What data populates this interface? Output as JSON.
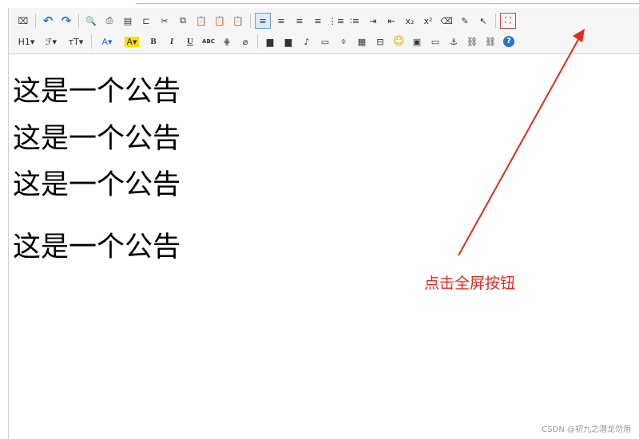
{
  "toolbar": {
    "row1": [
      {
        "name": "source-icon",
        "glyph": "⌧"
      },
      {
        "sep": true
      },
      {
        "name": "undo-icon",
        "glyph": "↶"
      },
      {
        "name": "redo-icon",
        "glyph": "↷"
      },
      {
        "sep": true
      },
      {
        "name": "preview-icon",
        "glyph": "🔍"
      },
      {
        "name": "print-icon",
        "glyph": "⎙"
      },
      {
        "name": "template-icon",
        "glyph": "▤"
      },
      {
        "name": "code-icon",
        "glyph": "⊏"
      },
      {
        "name": "cut-icon",
        "glyph": "✂"
      },
      {
        "name": "copy-icon",
        "glyph": "⧉"
      },
      {
        "name": "paste-icon",
        "glyph": "📋"
      },
      {
        "name": "paste-text-icon",
        "glyph": "📋"
      },
      {
        "name": "paste-word-icon",
        "glyph": "📋"
      },
      {
        "sep": true
      },
      {
        "name": "align-left-icon",
        "glyph": "≡",
        "active": true
      },
      {
        "name": "align-center-icon",
        "glyph": "≡"
      },
      {
        "name": "align-right-icon",
        "glyph": "≡"
      },
      {
        "name": "align-justify-icon",
        "glyph": "≡"
      },
      {
        "name": "ordered-list-icon",
        "glyph": "⋮≡"
      },
      {
        "name": "unordered-list-icon",
        "glyph": "∶≡"
      },
      {
        "name": "indent-icon",
        "glyph": "⇥"
      },
      {
        "name": "outdent-icon",
        "glyph": "⇤"
      },
      {
        "name": "subscript-icon",
        "glyph": "x₂"
      },
      {
        "name": "superscript-icon",
        "glyph": "x²"
      },
      {
        "name": "clear-format-icon",
        "glyph": "⌫"
      },
      {
        "name": "select-all-icon",
        "glyph": "✎"
      },
      {
        "name": "pointer-icon",
        "glyph": "↖"
      },
      {
        "sep": true
      },
      {
        "name": "fullscreen-icon",
        "glyph": "⛶"
      }
    ],
    "row2": [
      {
        "name": "heading-dropdown",
        "label": "H1▾",
        "wide": true
      },
      {
        "name": "font-family-dropdown",
        "label": "ℱ▾",
        "wide": true
      },
      {
        "name": "font-size-dropdown",
        "label": "тT▾",
        "wide": true
      },
      {
        "sep": true
      },
      {
        "name": "text-color-dropdown",
        "label": "A▾",
        "wide": true
      },
      {
        "name": "highlight-color-dropdown",
        "label": "A▾",
        "wide": true,
        "highlight": true
      },
      {
        "name": "bold-icon",
        "label": "B"
      },
      {
        "name": "italic-icon",
        "label": "I"
      },
      {
        "name": "underline-icon",
        "label": "U"
      },
      {
        "name": "strikethrough-icon",
        "label": "ABC"
      },
      {
        "name": "hr-icon",
        "label": "⋕"
      },
      {
        "name": "eraser-icon",
        "label": "⌀"
      },
      {
        "sep": true
      },
      {
        "name": "insert-image-icon",
        "label": "▆"
      },
      {
        "name": "insert-flash-icon",
        "label": "▆"
      },
      {
        "name": "insert-media-icon",
        "label": "♪"
      },
      {
        "name": "insert-video-icon",
        "label": "▭"
      },
      {
        "name": "attachment-icon",
        "label": "⌽"
      },
      {
        "name": "insert-table-icon",
        "label": "▦"
      },
      {
        "name": "insert-code-icon",
        "label": "⊟"
      },
      {
        "name": "emoticon-icon",
        "label": "☺"
      },
      {
        "name": "map-icon",
        "label": "▣"
      },
      {
        "name": "pagebreak-icon",
        "label": "▭"
      },
      {
        "name": "anchor-icon",
        "label": "⚓"
      },
      {
        "name": "link-icon",
        "label": "⛓"
      },
      {
        "name": "unlink-icon",
        "label": "⛓"
      },
      {
        "name": "help-icon",
        "label": "?"
      }
    ]
  },
  "content": {
    "paragraphs": [
      "这是一个公告",
      "这是一个公告",
      "这是一个公告",
      "这是一个公告"
    ]
  },
  "annotation": {
    "text": "点击全屏按钮",
    "color": "#e8281e"
  },
  "watermark": "CSDN @初九之潜龙勿用"
}
